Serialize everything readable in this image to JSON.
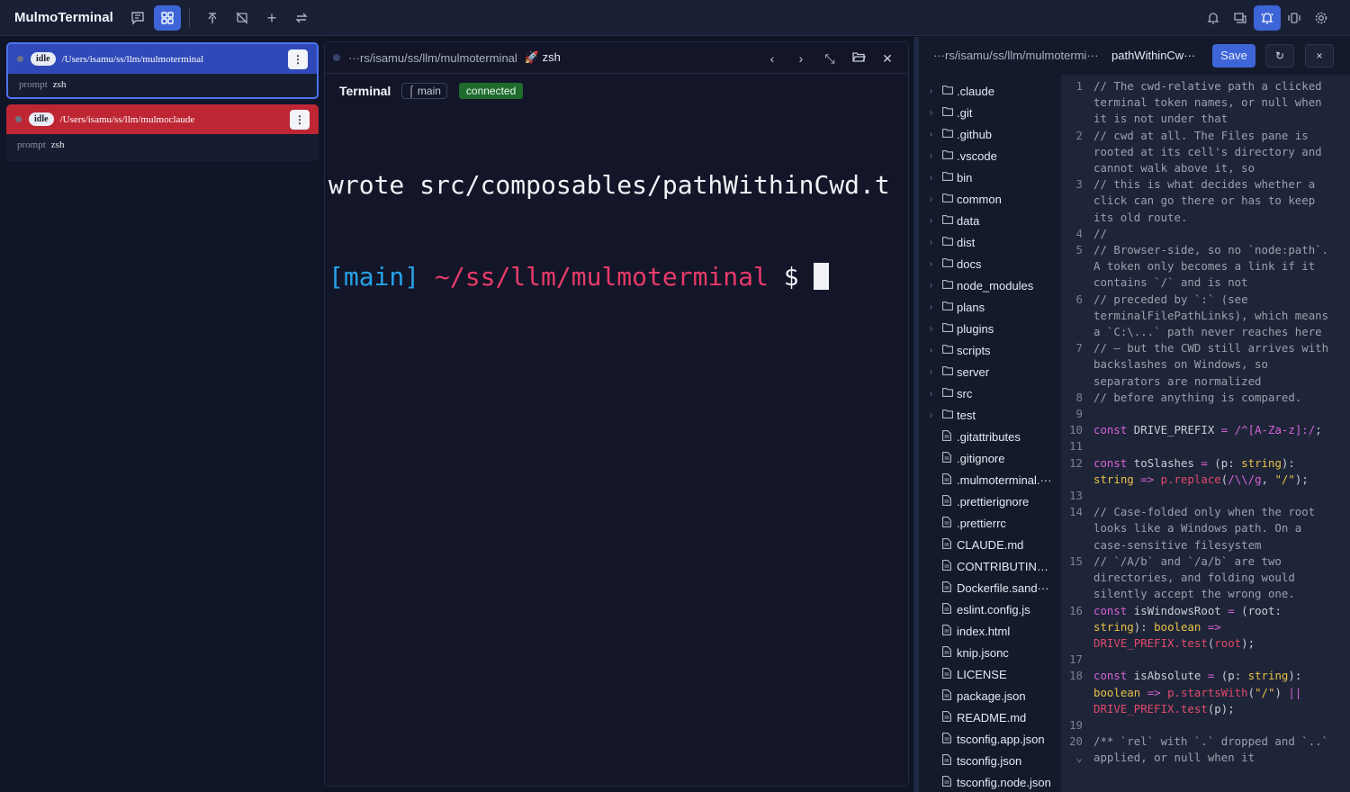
{
  "app": {
    "title": "MulmoTerminal"
  },
  "toolbar": {
    "icons": [
      "chat-icon",
      "grid-icon",
      "merge-icon",
      "sync-off-icon",
      "plus-icon",
      "swap-icon"
    ],
    "right_icons": [
      "bell-icon",
      "devices-icon",
      "bell-active-icon",
      "vibrate-icon",
      "gear-icon"
    ]
  },
  "sessions": [
    {
      "status": "idle",
      "path": "/Users/isamu/ss/llm/mulmoterminal",
      "prompt_label": "prompt",
      "prompt_value": "zsh"
    },
    {
      "status": "idle",
      "path": "/Users/isamu/ss/llm/mulmoclaude",
      "prompt_label": "prompt",
      "prompt_value": "zsh"
    }
  ],
  "terminal": {
    "path": "···rs/isamu/ss/llm/mulmoterminal",
    "process": "🚀 zsh",
    "title": "Terminal",
    "branch": "⌠ main",
    "status": "connected",
    "line1": "wrote src/composables/pathWithinCwd.t",
    "prompt_branch": "[main]",
    "prompt_path": "~/ss/llm/mulmoterminal",
    "prompt_dollar": "$"
  },
  "editor_head": {
    "path": "···rs/isamu/ss/llm/mulmotermi···",
    "file": "pathWithinCw···",
    "save": "Save",
    "reload": "↻",
    "close": "×"
  },
  "files": [
    {
      "name": ".claude",
      "dir": true
    },
    {
      "name": ".git",
      "dir": true
    },
    {
      "name": ".github",
      "dir": true
    },
    {
      "name": ".vscode",
      "dir": true
    },
    {
      "name": "bin",
      "dir": true
    },
    {
      "name": "common",
      "dir": true
    },
    {
      "name": "data",
      "dir": true
    },
    {
      "name": "dist",
      "dir": true
    },
    {
      "name": "docs",
      "dir": true
    },
    {
      "name": "node_modules",
      "dir": true
    },
    {
      "name": "plans",
      "dir": true
    },
    {
      "name": "plugins",
      "dir": true
    },
    {
      "name": "scripts",
      "dir": true
    },
    {
      "name": "server",
      "dir": true
    },
    {
      "name": "src",
      "dir": true
    },
    {
      "name": "test",
      "dir": true
    },
    {
      "name": ".gitattributes",
      "dir": false
    },
    {
      "name": ".gitignore",
      "dir": false
    },
    {
      "name": ".mulmoterminal.···",
      "dir": false
    },
    {
      "name": ".prettierignore",
      "dir": false
    },
    {
      "name": ".prettierrc",
      "dir": false
    },
    {
      "name": "CLAUDE.md",
      "dir": false
    },
    {
      "name": "CONTRIBUTING···",
      "dir": false
    },
    {
      "name": "Dockerfile.sand···",
      "dir": false
    },
    {
      "name": "eslint.config.js",
      "dir": false
    },
    {
      "name": "index.html",
      "dir": false
    },
    {
      "name": "knip.jsonc",
      "dir": false
    },
    {
      "name": "LICENSE",
      "dir": false
    },
    {
      "name": "package.json",
      "dir": false
    },
    {
      "name": "README.md",
      "dir": false
    },
    {
      "name": "tsconfig.app.json",
      "dir": false
    },
    {
      "name": "tsconfig.json",
      "dir": false
    },
    {
      "name": "tsconfig.node.json",
      "dir": false
    }
  ],
  "code": [
    {
      "n": "1",
      "t": [
        [
          "cm",
          "// The cwd-relative path a clicked terminal token names, or null when it is not under that"
        ]
      ]
    },
    {
      "n": "2",
      "t": [
        [
          "cm",
          "// cwd at all. The Files pane is rooted at its cell's directory and cannot walk above it, so"
        ]
      ]
    },
    {
      "n": "3",
      "t": [
        [
          "cm",
          "// this is what decides whether a click can go there or has to keep its old route."
        ]
      ]
    },
    {
      "n": "4",
      "t": [
        [
          "cm",
          "//"
        ]
      ]
    },
    {
      "n": "5",
      "t": [
        [
          "cm",
          "// Browser-side, so no `node:path`. A token only becomes a link if it contains `/` and is not"
        ]
      ]
    },
    {
      "n": "6",
      "t": [
        [
          "cm",
          "// preceded by `:` (see terminalFilePathLinks), which means a `C:\\...` path never reaches here"
        ]
      ]
    },
    {
      "n": "7",
      "t": [
        [
          "cm",
          "// — but the CWD still arrives with backslashes on Windows, so separators are normalized"
        ]
      ]
    },
    {
      "n": "8",
      "t": [
        [
          "cm",
          "// before anything is compared."
        ]
      ]
    },
    {
      "n": "9",
      "t": [
        [
          "",
          ""
        ]
      ]
    },
    {
      "n": "10",
      "t": [
        [
          "kw",
          "const"
        ],
        [
          "",
          " DRIVE_PREFIX "
        ],
        [
          "kw",
          "="
        ],
        [
          "",
          " "
        ],
        [
          "rx",
          "/^[A-Za-z]:/"
        ],
        [
          "",
          ";"
        ]
      ]
    },
    {
      "n": "11",
      "t": [
        [
          "",
          ""
        ]
      ]
    },
    {
      "n": "12",
      "t": [
        [
          "kw",
          "const"
        ],
        [
          "",
          " toSlashes "
        ],
        [
          "kw",
          "="
        ],
        [
          "",
          " (p: "
        ],
        [
          "ty",
          "string"
        ],
        [
          "",
          "): "
        ],
        [
          "ty",
          "string"
        ],
        [
          "",
          " "
        ],
        [
          "kw",
          "=>"
        ],
        [
          "",
          " "
        ],
        [
          "fn",
          "p.replace"
        ],
        [
          "",
          "("
        ],
        [
          "rx",
          "/\\\\/g"
        ],
        [
          "",
          ", "
        ],
        [
          "st",
          "\"/\""
        ],
        [
          "",
          ");"
        ]
      ]
    },
    {
      "n": "13",
      "t": [
        [
          "",
          ""
        ]
      ]
    },
    {
      "n": "14",
      "t": [
        [
          "cm",
          "// Case-folded only when the root looks like a Windows path. On a case-sensitive filesystem"
        ]
      ]
    },
    {
      "n": "15",
      "t": [
        [
          "cm",
          "// `/A/b` and `/a/b` are two directories, and folding would silently accept the wrong one."
        ]
      ]
    },
    {
      "n": "16",
      "t": [
        [
          "kw",
          "const"
        ],
        [
          "",
          " isWindowsRoot "
        ],
        [
          "kw",
          "="
        ],
        [
          "",
          " (root: "
        ],
        [
          "ty",
          "string"
        ],
        [
          "",
          "): "
        ],
        [
          "ty",
          "boolean"
        ],
        [
          "",
          " "
        ],
        [
          "kw",
          "=>"
        ],
        [
          "",
          " "
        ],
        [
          "fn",
          "DRIVE_PREFIX.test"
        ],
        [
          "",
          "("
        ],
        [
          "fn",
          "root"
        ],
        [
          "",
          ");"
        ]
      ]
    },
    {
      "n": "17",
      "t": [
        [
          "",
          ""
        ]
      ]
    },
    {
      "n": "18",
      "t": [
        [
          "kw",
          "const"
        ],
        [
          "",
          " isAbsolute "
        ],
        [
          "kw",
          "="
        ],
        [
          "",
          " (p: "
        ],
        [
          "ty",
          "string"
        ],
        [
          "",
          "): "
        ],
        [
          "ty",
          "boolean"
        ],
        [
          "",
          " "
        ],
        [
          "kw",
          "=>"
        ],
        [
          "",
          " "
        ],
        [
          "fn",
          "p.startsWith"
        ],
        [
          "",
          "("
        ],
        [
          "st",
          "\"/\""
        ],
        [
          "",
          ") "
        ],
        [
          "kw",
          "||"
        ],
        [
          "",
          " "
        ],
        [
          "fn",
          "DRIVE_PREFIX.test"
        ],
        [
          "",
          "(p);"
        ]
      ]
    },
    {
      "n": "19",
      "t": [
        [
          "",
          ""
        ]
      ]
    },
    {
      "n": "20 ⌄",
      "t": [
        [
          "cm",
          "/** `rel` with `.` dropped and `..` applied, or null when it"
        ]
      ]
    }
  ]
}
